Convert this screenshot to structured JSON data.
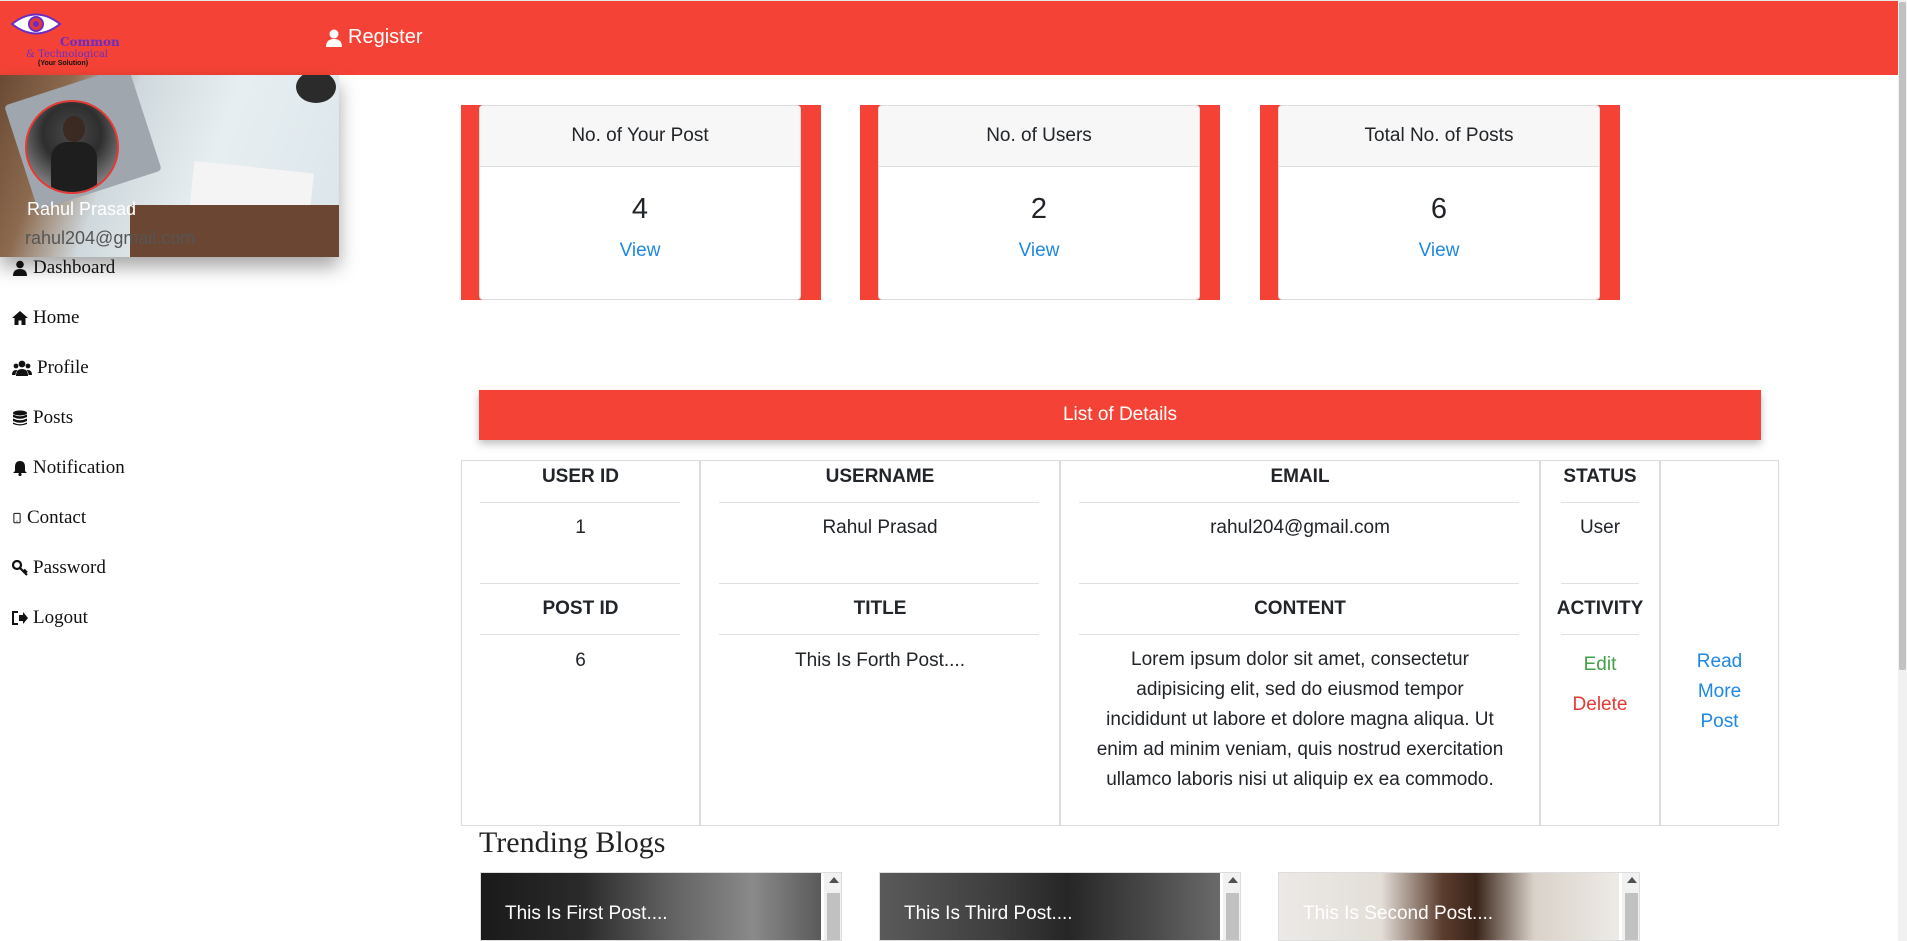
{
  "app": {
    "logo": {
      "line1": "Common",
      "line2": "& Technological",
      "line3": "(Your Solution)"
    },
    "nav": {
      "register_label": "Register"
    }
  },
  "profile": {
    "name": "Rahul Prasad",
    "email": "rahul204@gmail.com"
  },
  "sidebar": {
    "items": [
      {
        "label": "Dashboard",
        "icon": "user-icon"
      },
      {
        "label": "Home",
        "icon": "home-icon"
      },
      {
        "label": "Profile",
        "icon": "users-icon"
      },
      {
        "label": "Posts",
        "icon": "database-icon"
      },
      {
        "label": "Notification",
        "icon": "bell-icon"
      },
      {
        "label": "Contact",
        "icon": "mobile-icon"
      },
      {
        "label": "Password",
        "icon": "key-icon"
      },
      {
        "label": "Logout",
        "icon": "sign-out-icon"
      }
    ]
  },
  "stats": [
    {
      "title": "No. of Your Post",
      "value": "4",
      "link": "View"
    },
    {
      "title": "No. of Users",
      "value": "2",
      "link": "View"
    },
    {
      "title": "Total No. of Posts",
      "value": "6",
      "link": "View"
    }
  ],
  "details": {
    "banner": "List of Details",
    "user_headers": {
      "user_id": "USER ID",
      "username": "USERNAME",
      "email": "EMAIL",
      "status": "STATUS"
    },
    "user_row": {
      "user_id": "1",
      "username": "Rahul Prasad",
      "email": "rahul204@gmail.com",
      "status": "User"
    },
    "post_headers": {
      "post_id": "POST ID",
      "title": "TITLE",
      "content": "CONTENT",
      "activity": "ACTIVITY"
    },
    "post_row": {
      "post_id": "6",
      "title": "This Is Forth Post....",
      "content_lines": [
        "Lorem ipsum dolor sit amet, consectetur",
        "adipisicing elit, sed do eiusmod tempor",
        "incididunt ut labore et dolore magna aliqua. Ut",
        "enim ad minim veniam, quis nostrud exercitation",
        "ullamco laboris nisi ut aliquip ex ea commodo."
      ],
      "edit": "Edit",
      "delete": "Delete",
      "read_more_lines": [
        "Read",
        "More",
        "Post"
      ]
    }
  },
  "trending": {
    "title": "Trending Blogs",
    "blogs": [
      {
        "title": "This Is First Post...."
      },
      {
        "title": "This Is Third Post...."
      },
      {
        "title": "This Is Second Post...."
      }
    ]
  },
  "colors": {
    "primary": "#f44336",
    "link": "#1e88e5",
    "edit": "#43a047",
    "delete": "#e53935"
  }
}
